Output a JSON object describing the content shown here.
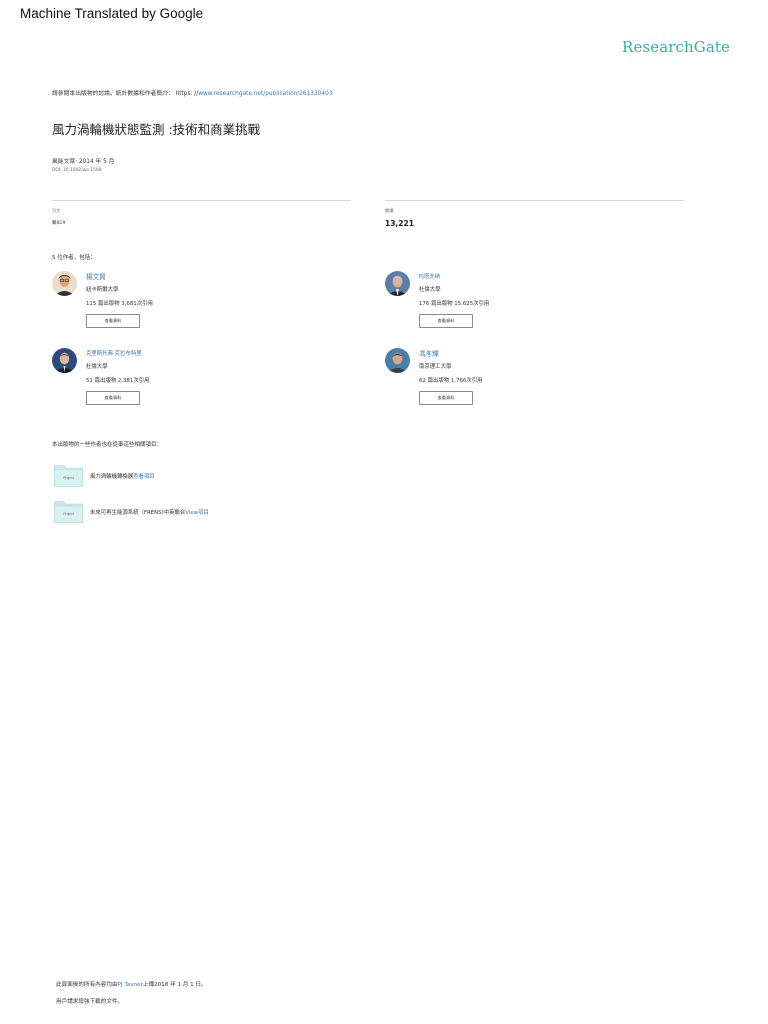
{
  "banner": {
    "text": "Machine Translated by Google"
  },
  "brand": {
    "logo_text": "ResearchGate",
    "color": "#2bb6a4"
  },
  "citation": {
    "prefix": "請參閱本出版物的討論、統計數據和作者簡介： https: //",
    "link_text": "www.researchgate.net/publication/261330403"
  },
  "publication": {
    "title": "風力渦輪機狀態監測 :技術和商業挑戰",
    "type_line": "風能文章· 2014 年 5 月",
    "doi": "DOI: 10.1002/we.1508"
  },
  "stats": {
    "citations_label": "引文",
    "citations_value": "聚819",
    "reads_label": "閱讀",
    "reads_value": "13,221"
  },
  "authors_heading": "5 位作者，包括：",
  "authors": [
    {
      "name": "楊文賢",
      "institution": "紐卡斯爾大學",
      "stats": "115 篇出版物 3,681次引用",
      "button": "查看資料"
    },
    {
      "name": "PJ塔夫納",
      "institution": "杜倫大學",
      "stats": "176 篇出版物 15,625次引用",
      "button": "查看資料"
    },
    {
      "name": "克里斯托弗·克拉布特里",
      "institution": "杜倫大學",
      "stats": "51 篇出版物 2,381次引用",
      "button": "查看資料"
    },
    {
      "name": "馮冬輝",
      "institution": "南京理工大學",
      "stats": "62 篇出版物 1,766次引用",
      "button": "查看資料"
    }
  ],
  "projects_heading": "本出版物的一些作者也在從事這些相關項目：",
  "projects": [
    {
      "icon_label": "Project",
      "text": "風力渦輪機轉換器",
      "link": "查看項目"
    },
    {
      "icon_label": "Project",
      "text": "未來可再生能源系統（FRENS)中英聯合",
      "link": "View項目"
    }
  ],
  "footer": {
    "line1_prefix": "此頁面後的所有內容均由",
    "line1_link": "PJ Tavner",
    "line1_suffix": "上傳2018 年 1 月 1 日。",
    "line2": "用戶請求增強下載的文件。"
  }
}
